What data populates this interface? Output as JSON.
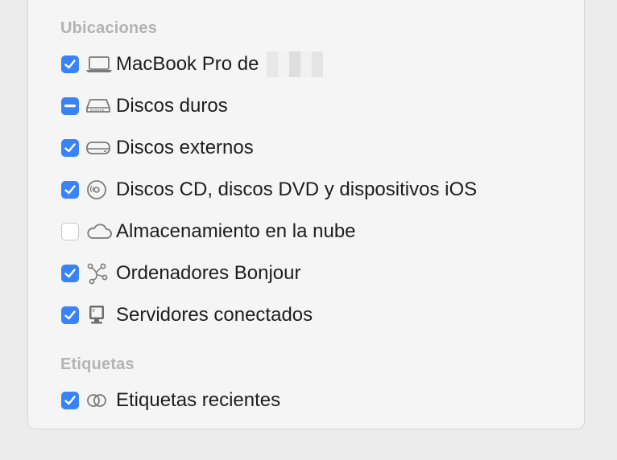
{
  "sections": {
    "locations": {
      "header": "Ubicaciones",
      "items": [
        {
          "label": "MacBook Pro de",
          "state": "checked",
          "icon": "laptop-icon"
        },
        {
          "label": "Discos duros",
          "state": "mixed",
          "icon": "hard-drive-icon"
        },
        {
          "label": "Discos externos",
          "state": "checked",
          "icon": "external-disk-icon"
        },
        {
          "label": "Discos CD, discos DVD y dispositivos iOS",
          "state": "checked",
          "icon": "cd-dvd-icon"
        },
        {
          "label": "Almacenamiento en la nube",
          "state": "unchecked",
          "icon": "cloud-icon"
        },
        {
          "label": "Ordenadores Bonjour",
          "state": "checked",
          "icon": "bonjour-icon"
        },
        {
          "label": "Servidores conectados",
          "state": "checked",
          "icon": "server-icon"
        }
      ]
    },
    "tags": {
      "header": "Etiquetas",
      "items": [
        {
          "label": "Etiquetas recientes",
          "state": "checked",
          "icon": "tags-icon"
        }
      ]
    }
  },
  "colors": {
    "accent": "#3a83f6"
  }
}
